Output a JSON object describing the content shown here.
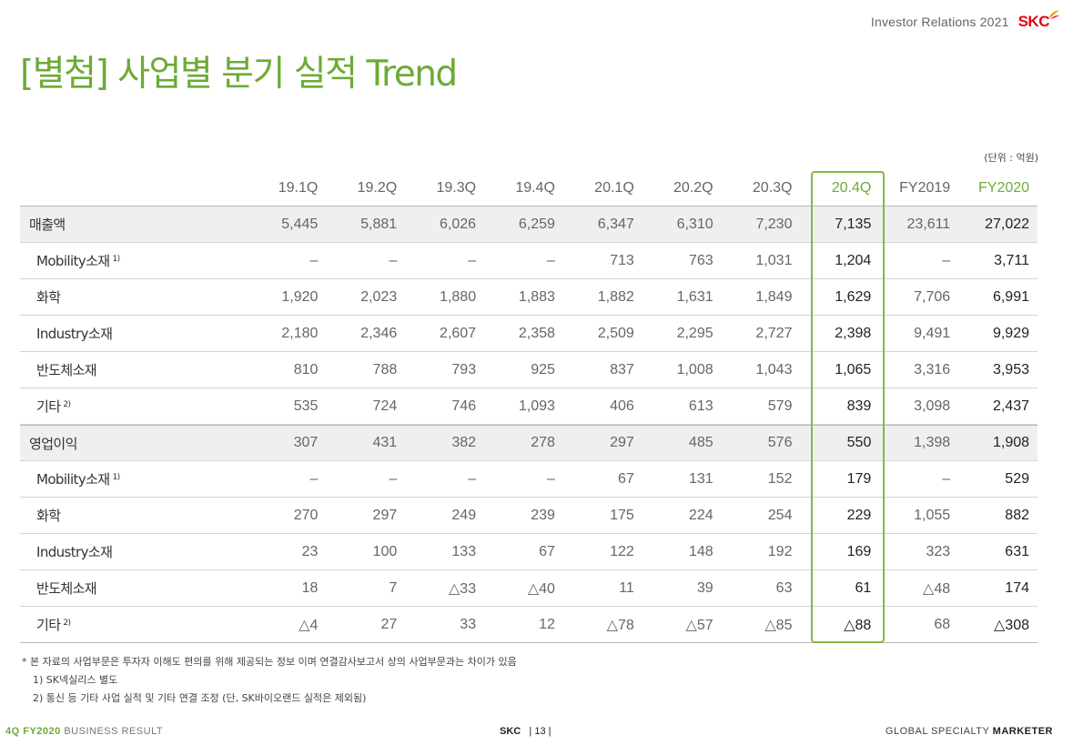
{
  "header": {
    "ir_label": "Investor Relations 2021",
    "logo_text": "SKC",
    "brand_color": "#e60012"
  },
  "title": "[별첨] 사업별 분기 실적 Trend",
  "accent_color": "#6cab36",
  "unit_note": "(단위 : 억원)",
  "table": {
    "columns": [
      "19.1Q",
      "19.2Q",
      "19.3Q",
      "19.4Q",
      "20.1Q",
      "20.2Q",
      "20.3Q",
      "20.4Q",
      "FY2019",
      "FY2020"
    ],
    "rows": [
      {
        "label": "매출액",
        "note": "",
        "values": [
          "5,445",
          "5,881",
          "6,026",
          "6,259",
          "6,347",
          "6,310",
          "7,230",
          "7,135",
          "23,611",
          "27,022"
        ]
      },
      {
        "label": "Mobility소재",
        "note": "1)",
        "values": [
          "–",
          "–",
          "–",
          "–",
          "713",
          "763",
          "1,031",
          "1,204",
          "–",
          "3,711"
        ]
      },
      {
        "label": "화학",
        "note": "",
        "values": [
          "1,920",
          "2,023",
          "1,880",
          "1,883",
          "1,882",
          "1,631",
          "1,849",
          "1,629",
          "7,706",
          "6,991"
        ]
      },
      {
        "label": "Industry소재",
        "note": "",
        "values": [
          "2,180",
          "2,346",
          "2,607",
          "2,358",
          "2,509",
          "2,295",
          "2,727",
          "2,398",
          "9,491",
          "9,929"
        ]
      },
      {
        "label": "반도체소재",
        "note": "",
        "values": [
          "810",
          "788",
          "793",
          "925",
          "837",
          "1,008",
          "1,043",
          "1,065",
          "3,316",
          "3,953"
        ]
      },
      {
        "label": "기타",
        "note": "2)",
        "values": [
          "535",
          "724",
          "746",
          "1,093",
          "406",
          "613",
          "579",
          "839",
          "3,098",
          "2,437"
        ]
      },
      {
        "label": "영업이익",
        "note": "",
        "values": [
          "307",
          "431",
          "382",
          "278",
          "297",
          "485",
          "576",
          "550",
          "1,398",
          "1,908"
        ]
      },
      {
        "label": "Mobility소재",
        "note": "1)",
        "values": [
          "–",
          "–",
          "–",
          "–",
          "67",
          "131",
          "152",
          "179",
          "–",
          "529"
        ]
      },
      {
        "label": "화학",
        "note": "",
        "values": [
          "270",
          "297",
          "249",
          "239",
          "175",
          "224",
          "254",
          "229",
          "1,055",
          "882"
        ]
      },
      {
        "label": "Industry소재",
        "note": "",
        "values": [
          "23",
          "100",
          "133",
          "67",
          "122",
          "148",
          "192",
          "169",
          "323",
          "631"
        ]
      },
      {
        "label": "반도체소재",
        "note": "",
        "values": [
          "18",
          "7",
          "△33",
          "△40",
          "11",
          "39",
          "63",
          "61",
          "△48",
          "174"
        ]
      },
      {
        "label": "기타",
        "note": "2)",
        "values": [
          "△4",
          "27",
          "33",
          "12",
          "△78",
          "△57",
          "△85",
          "△88",
          "68",
          "△308"
        ]
      }
    ]
  },
  "notes": [
    "* 본 자료의 사업부문은 투자자 이해도 편의를 위해 제공되는 정보 이며 연결감사보고서 상의 사업부문과는 차이가 있음",
    "1) SK넥실리스 별도",
    "2) 통신 등 기타 사업 실적 및 기타 연결 조정 (단, SK바이오랜드 실적은 제외됨)"
  ],
  "footer": {
    "left_bold": "4Q FY2020",
    "left_rest": " BUSINESS RESULT",
    "center_brand": "SKC",
    "center_page": "| 13 |",
    "right_rest": "GLOBAL SPECIALTY ",
    "right_bold": "MARKETER"
  }
}
